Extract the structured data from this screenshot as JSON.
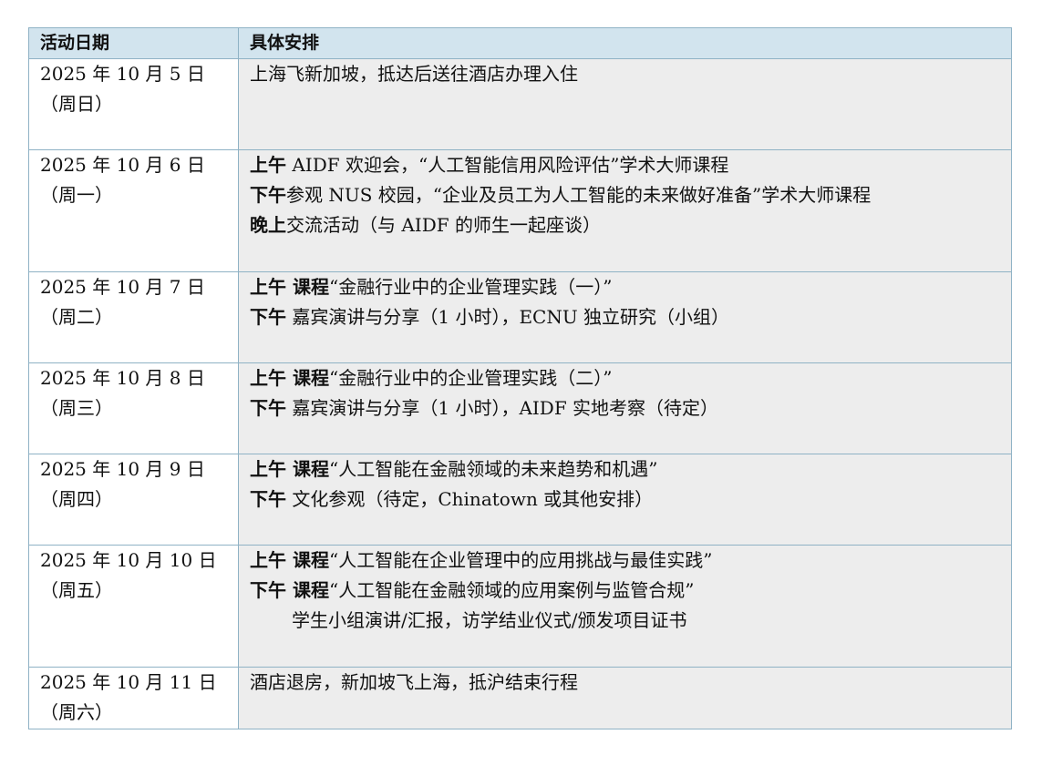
{
  "headers": {
    "date": "活动日期",
    "plan": "具体安排"
  },
  "rows": [
    {
      "date": "2025 年 10 月 5 日",
      "weekday": "（周日）",
      "lines": [
        {
          "label": "",
          "text": "上海飞新加坡，抵达后送往酒店办理入住"
        }
      ]
    },
    {
      "date": "2025 年 10 月 6 日",
      "weekday": "（周一）",
      "lines": [
        {
          "label": "上午",
          "text": " AIDF 欢迎会，“人工智能信用风险评估”学术大师课程"
        },
        {
          "label": "下午",
          "text": "参观 NUS 校园，“企业及员工为人工智能的未来做好准备”学术大师课程"
        },
        {
          "label": "晚上",
          "text": "交流活动（与 AIDF 的师生一起座谈）"
        }
      ]
    },
    {
      "date": "2025 年 10 月 7 日",
      "weekday": "（周二）",
      "lines": [
        {
          "label": "上午 课程",
          "text": "“金融行业中的企业管理实践（一）”"
        },
        {
          "label": "下午",
          "text": " 嘉宾演讲与分享（1 小时），ECNU 独立研究（小组）"
        }
      ]
    },
    {
      "date": "2025 年 10 月 8 日",
      "weekday": "（周三）",
      "lines": [
        {
          "label": "上午 课程",
          "text": "“金融行业中的企业管理实践（二）”"
        },
        {
          "label": "下午",
          "text": " 嘉宾演讲与分享（1 小时），AIDF 实地考察（待定）"
        }
      ]
    },
    {
      "date": "2025 年 10 月 9 日",
      "weekday": "（周四）",
      "lines": [
        {
          "label": "上午 课程",
          "text": "“人工智能在金融领域的未来趋势和机遇”"
        },
        {
          "label": "下午",
          "text": " 文化参观（待定，Chinatown 或其他安排）"
        }
      ]
    },
    {
      "date": "2025 年 10 月 10 日",
      "weekday": "（周五）",
      "lines": [
        {
          "label": "上午 课程",
          "text": "“人工智能在企业管理中的应用挑战与最佳实践”"
        },
        {
          "label": "下午 课程",
          "text": "“人工智能在金融领域的应用案例与监管合规”"
        },
        {
          "label": "",
          "text": "学生小组演讲/汇报，访学结业仪式/颁发项目证书",
          "indent": true
        }
      ]
    },
    {
      "date": "2025 年 10 月 11 日",
      "weekday": "（周六）",
      "lines": [
        {
          "label": "",
          "text": "酒店退房，新加坡飞上海，抵沪结束行程"
        }
      ]
    }
  ]
}
